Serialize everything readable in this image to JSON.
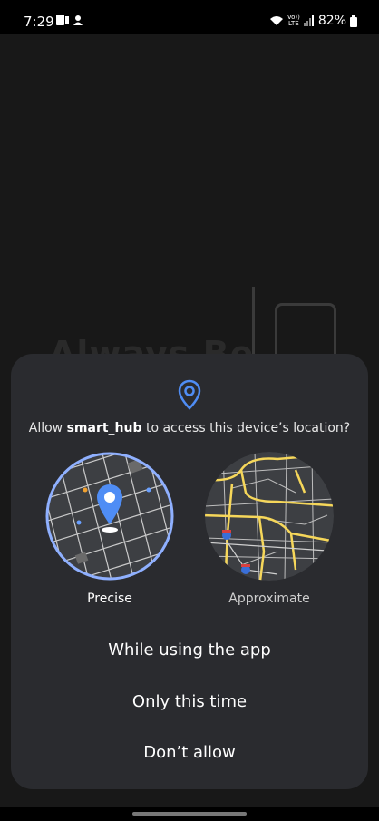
{
  "status": {
    "time": "7:29",
    "battery": "82%",
    "network_label": "Vo)) LTE"
  },
  "background": {
    "partial_text": "Always Be"
  },
  "dialog": {
    "prompt_prefix": "Allow ",
    "app_name": "smart_hub",
    "prompt_suffix": " to access this device’s location?",
    "options": {
      "precise_label": "Precise",
      "approximate_label": "Approximate"
    },
    "choices": {
      "while_using": "While using the app",
      "only_this_time": "Only this time",
      "dont_allow": "Don’t allow"
    }
  },
  "colors": {
    "accent": "#7ea6ff",
    "pin_blue": "#4f8df5",
    "dialog_bg": "#2a2b2f",
    "map_bg": "#3d3f43",
    "road_yellow": "#f6d75a"
  }
}
